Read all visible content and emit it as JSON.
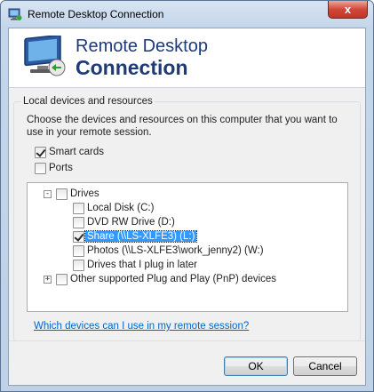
{
  "window": {
    "title": "Remote Desktop Connection",
    "close_label": "x"
  },
  "banner": {
    "line1": "Remote Desktop",
    "line2": "Connection"
  },
  "group": {
    "label": "Local devices and resources",
    "description": "Choose the devices and resources on this computer that you want to use in your remote session."
  },
  "options": {
    "smart_cards": {
      "label": "Smart cards",
      "checked": true
    },
    "ports": {
      "label": "Ports",
      "checked": false
    }
  },
  "tree": {
    "drives": {
      "label": "Drives",
      "expander": "-",
      "children": [
        {
          "label": "Local Disk (C:)",
          "checked": false
        },
        {
          "label": "DVD RW Drive (D:)",
          "checked": false
        },
        {
          "label": "Share (\\\\LS-XLFE3) (L:)",
          "checked": true,
          "selected": true
        },
        {
          "label": "Photos (\\\\LS-XLFE3\\work_jenny2) (W:)",
          "checked": false
        },
        {
          "label": "Drives that I plug in later",
          "checked": false
        }
      ]
    },
    "pnp": {
      "label": "Other supported Plug and Play (PnP) devices",
      "expander": "+"
    }
  },
  "help_link": "Which devices can I use in my remote session?",
  "buttons": {
    "ok": "OK",
    "cancel": "Cancel"
  },
  "colors": {
    "title_blue": "#1e3a78",
    "link": "#0066cc",
    "selection": "#3399ff",
    "close_red": "#d3473a"
  }
}
